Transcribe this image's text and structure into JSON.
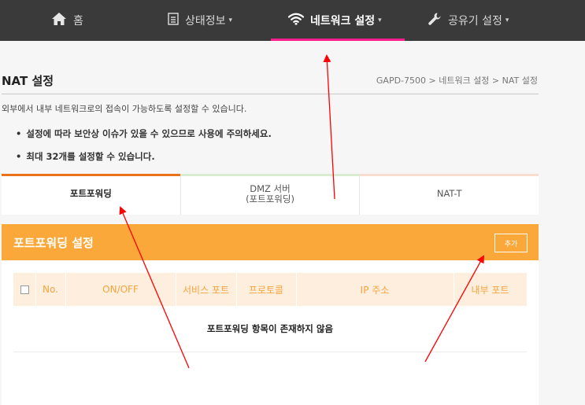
{
  "nav": {
    "items": [
      {
        "label": "홈",
        "icon": "home-icon",
        "caret": ""
      },
      {
        "label": "상태정보",
        "icon": "list-icon",
        "caret": "▾"
      },
      {
        "label": "네트워크 설정",
        "icon": "wifi-icon",
        "caret": "▾"
      },
      {
        "label": "공유기 설정",
        "icon": "wrench-icon",
        "caret": "▾"
      }
    ],
    "active_index": 2,
    "accent": "#ff1e8c"
  },
  "page": {
    "title": "NAT 설정",
    "breadcrumb": "GAPD-7500 > 네트워크 설정 > NAT 설정",
    "description": "외부에서 내부 네트워크로의 접속이 가능하도록 설정할 수 있습니다.",
    "notes": [
      "설정에 따라 보안상 이슈가 있을 수 있으므로 사용에 주의하세요.",
      "최대 32개를 설정할 수 있습니다."
    ]
  },
  "tabs": [
    {
      "label": "포트포워딩",
      "active": true,
      "bar_color": "#e8731a"
    },
    {
      "label": "DMZ 서버\n(포트포워딩)",
      "active": false,
      "bar_color": "#d7ecd0"
    },
    {
      "label": "NAT-T",
      "active": false,
      "bar_color": "#f8dccf"
    }
  ],
  "panel": {
    "title": "포트포워딩 설정",
    "add_label": "추가",
    "header_color": "#fba83a",
    "columns": [
      "No.",
      "ON/OFF",
      "서비스 포트",
      "프로토콜",
      "IP 주소",
      "내부 포트"
    ],
    "empty_message": "포트포워딩 항목이 존재하지 않음"
  },
  "annotation_color": "#ff0000"
}
